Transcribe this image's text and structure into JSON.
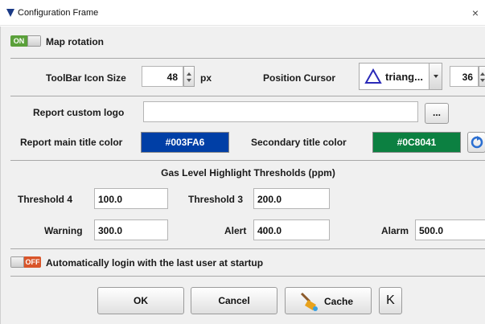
{
  "window": {
    "title": "Configuration Frame",
    "close_glyph": "×"
  },
  "map_rotation": {
    "toggle_state": "ON",
    "label": "Map rotation"
  },
  "toolbar_row": {
    "icon_size_label": "ToolBar Icon Size",
    "icon_size_value": "48",
    "icon_size_unit": "px",
    "position_cursor_label": "Position Cursor",
    "position_cursor_value": "triang...",
    "cursor_size_value": "36"
  },
  "report": {
    "custom_logo_label": "Report custom logo",
    "custom_logo_value": "",
    "browse_label": "...",
    "main_title_color_label": "Report main title color",
    "main_title_color_value": "#003FA6",
    "secondary_title_color_label": "Secondary title color",
    "secondary_title_color_value": "#0C8041",
    "reset_icon": "reset-colors-icon"
  },
  "thresholds": {
    "title": "Gas Level Highlight Thresholds (ppm)",
    "threshold4_label": "Threshold 4",
    "threshold4_value": "100.0",
    "threshold3_label": "Threshold 3",
    "threshold3_value": "200.0",
    "warning_label": "Warning",
    "warning_value": "300.0",
    "alert_label": "Alert",
    "alert_value": "400.0",
    "alarm_label": "Alarm",
    "alarm_value": "500.0"
  },
  "auto_login": {
    "toggle_state": "OFF",
    "label": "Automatically login with the last user at startup"
  },
  "footer": {
    "ok_label": "OK",
    "cancel_label": "Cancel",
    "cache_label": "Cache",
    "k_label": "K"
  },
  "colors": {
    "main_title": "#003FA6",
    "secondary_title": "#0C8041",
    "toggle_on": "#5AA03A",
    "toggle_off": "#D9552A"
  }
}
